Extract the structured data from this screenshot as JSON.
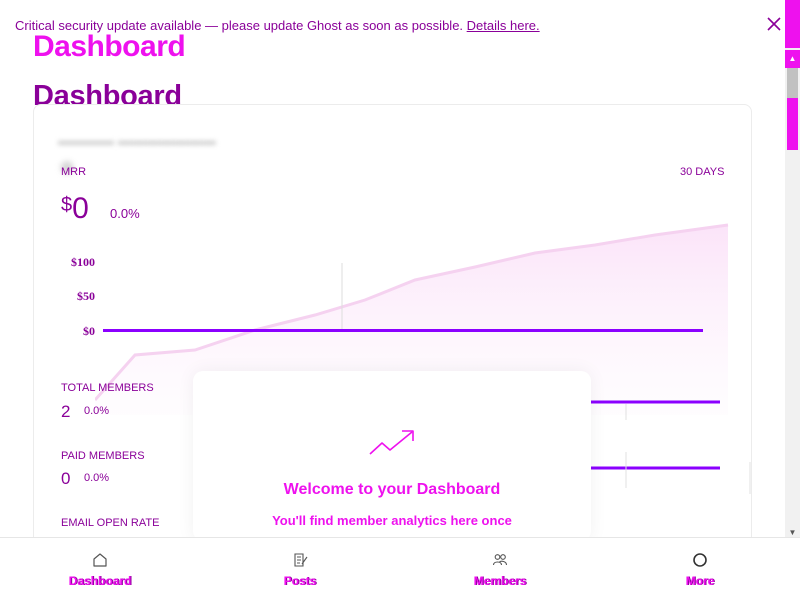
{
  "alert": {
    "message": "Critical security update available — please update Ghost as soon as possible.",
    "link_text": "Details here.",
    "close_icon": "close-icon"
  },
  "page": {
    "title_overlay": "Dashboard",
    "title": "Dashboard"
  },
  "mrr": {
    "label": "MRR",
    "range": "30 DAYS",
    "currency": "$",
    "value": "0",
    "change": "0.0%",
    "ticks": [
      "$100",
      "$50",
      "$0"
    ]
  },
  "stats": [
    {
      "label": "TOTAL MEMBERS",
      "value": "2",
      "change": "0.0%"
    },
    {
      "label": "PAID MEMBERS",
      "value": "0",
      "change": "0.0%"
    },
    {
      "label": "EMAIL OPEN RATE"
    }
  ],
  "welcome": {
    "icon": "trend-up-icon",
    "title": "Welcome to your Dashboard",
    "body": "You'll find member analytics here once"
  },
  "nav": [
    {
      "label": "Dashboard",
      "icon": "home-icon"
    },
    {
      "label": "Posts",
      "icon": "posts-icon"
    },
    {
      "label": "Members",
      "icon": "members-icon"
    },
    {
      "label": "More",
      "icon": "more-icon"
    }
  ],
  "colors": {
    "magenta": "#ee11ee",
    "purple": "#8a0099",
    "line": "#8b00ff"
  }
}
